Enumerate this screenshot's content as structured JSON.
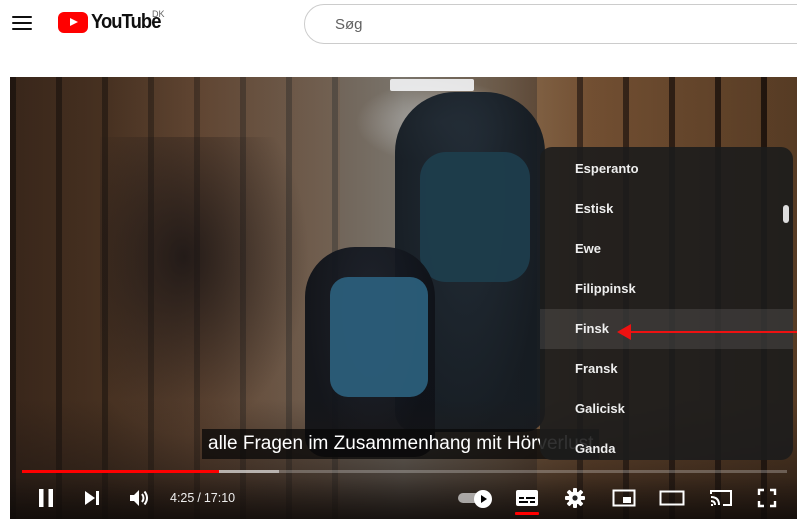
{
  "header": {
    "logo_text": "YouTube",
    "country_code": "DK",
    "search_placeholder": "Søg"
  },
  "player": {
    "caption": "alle Fragen im Zusammenhang mit Hörverlust",
    "progress_fraction": 0.258,
    "buffer_fraction": 0.336,
    "time_current": "4:25",
    "time_separator": "/",
    "time_total": "17:10",
    "autoplay_on": true,
    "subtitles_on": true,
    "accent_color": "#ff0000"
  },
  "language_menu": {
    "items": [
      {
        "label": "Esperanto",
        "highlighted": false
      },
      {
        "label": "Estisk",
        "highlighted": false
      },
      {
        "label": "Ewe",
        "highlighted": false
      },
      {
        "label": "Filippinsk",
        "highlighted": false
      },
      {
        "label": "Finsk",
        "highlighted": true
      },
      {
        "label": "Fransk",
        "highlighted": false
      },
      {
        "label": "Galicisk",
        "highlighted": false
      },
      {
        "label": "Ganda",
        "highlighted": false
      }
    ]
  },
  "icons": [
    "menu-icon",
    "youtube-logo-icon",
    "pause-icon",
    "next-icon",
    "volume-icon",
    "autoplay-toggle",
    "subtitles-icon",
    "settings-gear-icon",
    "miniplayer-icon",
    "theater-mode-icon",
    "cast-icon",
    "fullscreen-icon"
  ]
}
